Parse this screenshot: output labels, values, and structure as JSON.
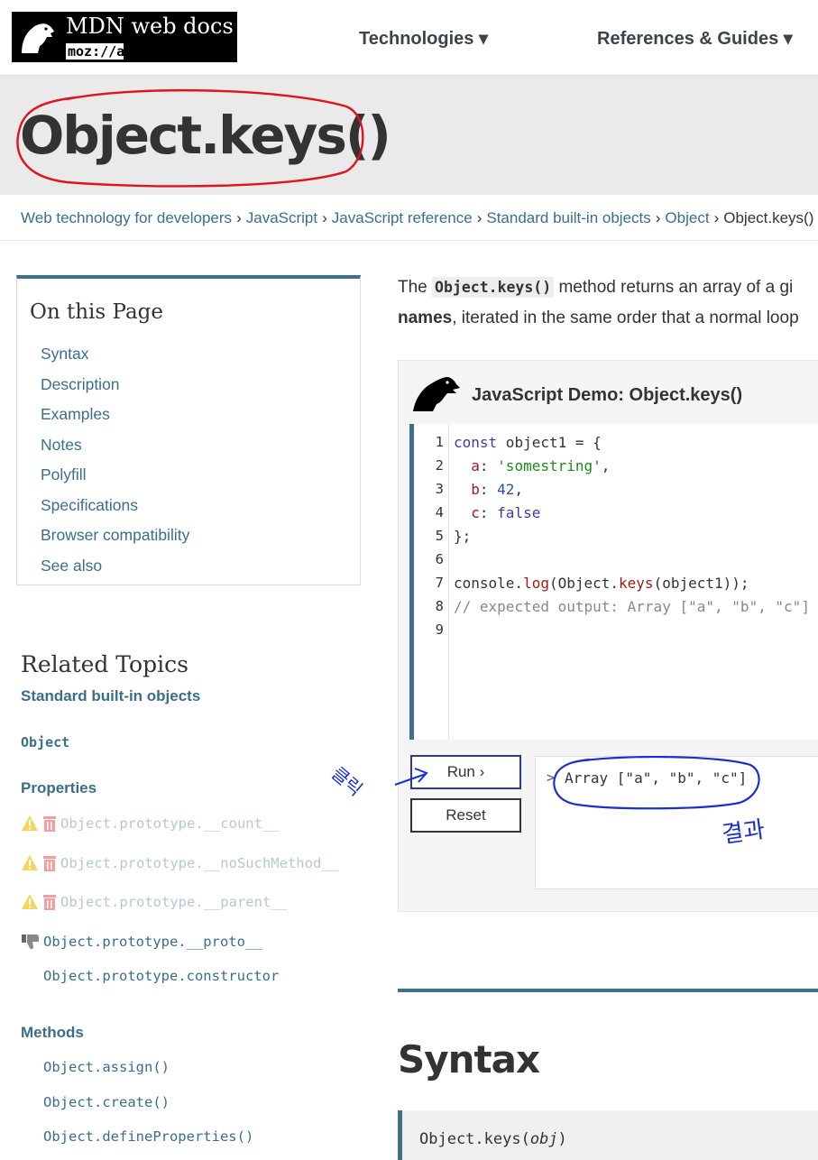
{
  "header": {
    "logo_title": "MDN web docs",
    "logo_moz": "moz://a",
    "nav": [
      {
        "label": "Technologies ▾"
      },
      {
        "label": "References & Guides ▾"
      }
    ]
  },
  "page": {
    "title": "Object.keys()"
  },
  "breadcrumb": [
    "Web technology for developers",
    "JavaScript",
    "JavaScript reference",
    "Standard built-in objects",
    "Object",
    "Object.keys()"
  ],
  "on_this_page": {
    "title": "On this Page",
    "items": [
      "Syntax",
      "Description",
      "Examples",
      "Notes",
      "Polyfill",
      "Specifications",
      "Browser compatibility",
      "See also"
    ]
  },
  "related": {
    "title": "Related Topics",
    "standard": "Standard built-in objects",
    "object": "Object",
    "properties_label": "Properties",
    "properties": [
      {
        "name": "Object.prototype.__count__",
        "status": "deprecated"
      },
      {
        "name": "Object.prototype.__noSuchMethod__",
        "status": "deprecated"
      },
      {
        "name": "Object.prototype.__parent__",
        "status": "deprecated"
      },
      {
        "name": "Object.prototype.__proto__",
        "status": "thumbs-down"
      },
      {
        "name": "Object.prototype.constructor",
        "status": "normal"
      }
    ],
    "methods_label": "Methods",
    "methods": [
      "Object.assign()",
      "Object.create()",
      "Object.defineProperties()"
    ]
  },
  "intro": {
    "line1_pre": "The ",
    "line1_code": "Object.keys()",
    "line1_post": " method returns an array of a gi",
    "line2_bold": "names",
    "line2_rest": ", iterated in the same order that a normal loop"
  },
  "demo": {
    "title": "JavaScript Demo: Object.keys()",
    "line_numbers": [
      "1",
      "2",
      "3",
      "4",
      "5",
      "6",
      "7",
      "8",
      "9"
    ],
    "run_label": "Run ›",
    "reset_label": "Reset",
    "output_prompt": ">",
    "output": "Array [\"a\", \"b\", \"c\"]"
  },
  "annotations": {
    "click_note": "클릭",
    "result_note": "결과"
  },
  "syntax": {
    "heading": "Syntax",
    "code_pre": "Object.keys(",
    "code_arg": "obj",
    "code_post": ")"
  },
  "colors": {
    "link": "#3a6e8a",
    "accent": "#3f6f8a",
    "annotation_red": "#e0141e",
    "annotation_blue": "#1a2fd0"
  }
}
